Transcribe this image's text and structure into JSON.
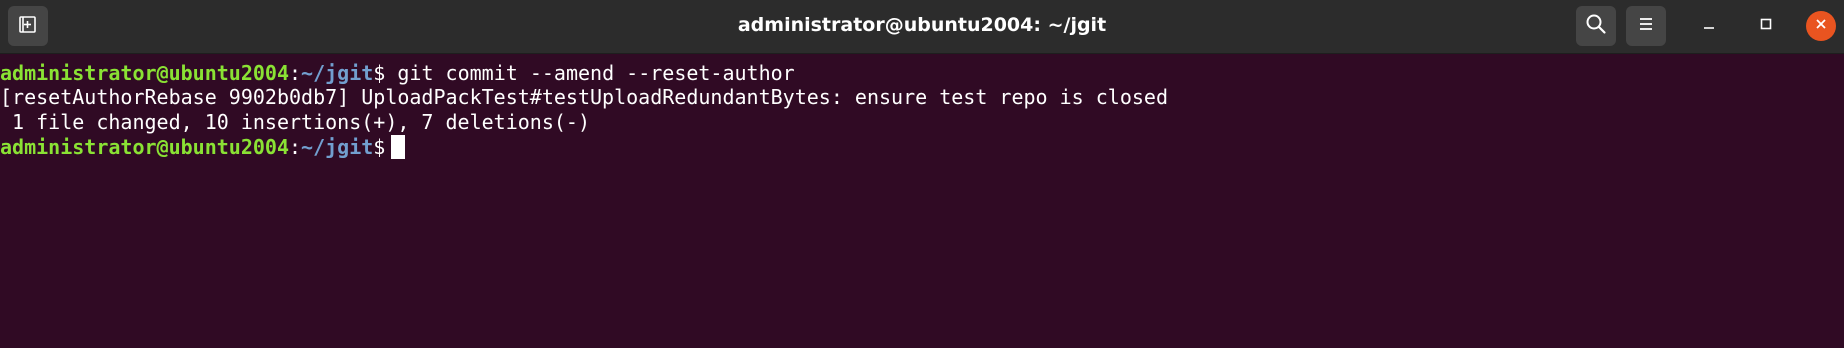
{
  "window": {
    "title": "administrator@ubuntu2004: ~/jgit"
  },
  "icons": {
    "new_tab": "new-tab-icon",
    "search": "search-icon",
    "menu": "hamburger-menu-icon",
    "minimize": "minimize-icon",
    "maximize": "maximize-icon",
    "close": "close-icon"
  },
  "colors": {
    "terminal_background": "#300a24",
    "titlebar_background": "#2c2c2c",
    "prompt_user": "#8ae234",
    "prompt_path": "#729fcf",
    "text": "#ffffff",
    "close_button": "#e95420"
  },
  "terminal": {
    "lines": [
      {
        "user": "administrator@ubuntu2004",
        "sep": ":",
        "path": "~/jgit",
        "dollar": "$",
        "command": " git commit --amend --reset-author"
      },
      {
        "text": "[resetAuthorRebase 9902b0db7] UploadPackTest#testUploadRedundantBytes: ensure test repo is closed"
      },
      {
        "text": " 1 file changed, 10 insertions(+), 7 deletions(-)"
      },
      {
        "user": "administrator@ubuntu2004",
        "sep": ":",
        "path": "~/jgit",
        "dollar": "$",
        "command": ""
      }
    ]
  }
}
